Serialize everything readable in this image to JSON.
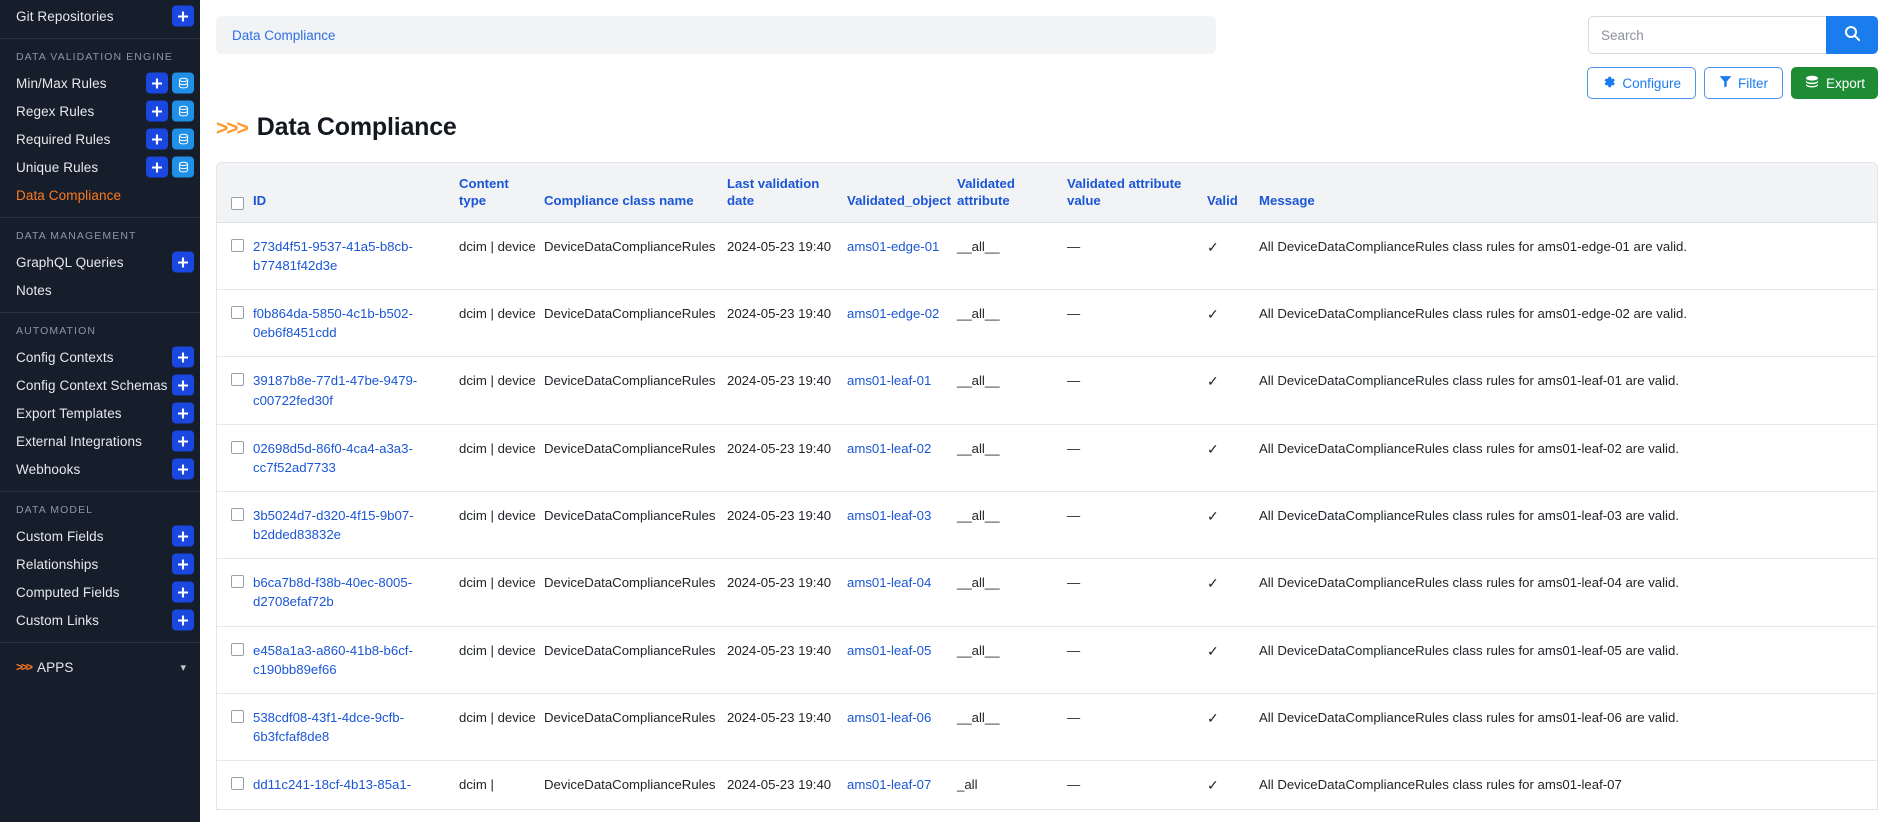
{
  "sidebar": {
    "top_item": {
      "label": "Git Repositories"
    },
    "sections": [
      {
        "title": "DATA VALIDATION ENGINE",
        "items": [
          {
            "label": "Min/Max Rules",
            "active": false,
            "add": "+",
            "import": "database-icon"
          },
          {
            "label": "Regex Rules",
            "active": false,
            "add": "+",
            "import": "database-icon"
          },
          {
            "label": "Required Rules",
            "active": false,
            "add": "+",
            "import": "database-icon"
          },
          {
            "label": "Unique Rules",
            "active": false,
            "add": "+",
            "import": "database-icon"
          },
          {
            "label": "Data Compliance",
            "active": true
          }
        ]
      },
      {
        "title": "DATA MANAGEMENT",
        "items": [
          {
            "label": "GraphQL Queries",
            "add": "+"
          },
          {
            "label": "Notes"
          }
        ]
      },
      {
        "title": "AUTOMATION",
        "items": [
          {
            "label": "Config Contexts",
            "add": "+"
          },
          {
            "label": "Config Context Schemas",
            "add": "+"
          },
          {
            "label": "Export Templates",
            "add": "+"
          },
          {
            "label": "External Integrations",
            "add": "+"
          },
          {
            "label": "Webhooks",
            "add": "+"
          }
        ]
      },
      {
        "title": "DATA MODEL",
        "items": [
          {
            "label": "Custom Fields",
            "add": "+"
          },
          {
            "label": "Relationships",
            "add": "+"
          },
          {
            "label": "Computed Fields",
            "add": "+"
          },
          {
            "label": "Custom Links",
            "add": "+"
          }
        ]
      }
    ],
    "apps": {
      "label": "APPS",
      "chevron": ">>>"
    }
  },
  "topbar": {
    "breadcrumb": "Data Compliance",
    "search": {
      "placeholder": "Search",
      "value": "",
      "button_icon": "search-icon"
    }
  },
  "actions": {
    "configure": "Configure",
    "filter": "Filter",
    "export": "Export"
  },
  "page": {
    "chevron": ">>>",
    "title": "Data Compliance"
  },
  "table": {
    "columns": [
      "ID",
      "Content type",
      "Compliance class name",
      "Last validation date",
      "Validated_object",
      "Validated attribute",
      "Validated attribute value",
      "Valid",
      "Message"
    ],
    "rows": [
      {
        "id": "273d4f51-9537-41a5-b8cb-b77481f42d3e",
        "content_type": "dcim | device",
        "class_name": "DeviceDataComplianceRules",
        "last_validation_date": "2024-05-23 19:40",
        "validated_object": "ams01-edge-01",
        "validated_attribute": "__all__",
        "validated_attribute_value": "—",
        "valid": "✓",
        "message": "All DeviceDataComplianceRules class rules for ams01-edge-01 are valid."
      },
      {
        "id": "f0b864da-5850-4c1b-b502-0eb6f8451cdd",
        "content_type": "dcim | device",
        "class_name": "DeviceDataComplianceRules",
        "last_validation_date": "2024-05-23 19:40",
        "validated_object": "ams01-edge-02",
        "validated_attribute": "__all__",
        "validated_attribute_value": "—",
        "valid": "✓",
        "message": "All DeviceDataComplianceRules class rules for ams01-edge-02 are valid."
      },
      {
        "id": "39187b8e-77d1-47be-9479-c00722fed30f",
        "content_type": "dcim | device",
        "class_name": "DeviceDataComplianceRules",
        "last_validation_date": "2024-05-23 19:40",
        "validated_object": "ams01-leaf-01",
        "validated_attribute": "__all__",
        "validated_attribute_value": "—",
        "valid": "✓",
        "message": "All DeviceDataComplianceRules class rules for ams01-leaf-01 are valid."
      },
      {
        "id": "02698d5d-86f0-4ca4-a3a3-cc7f52ad7733",
        "content_type": "dcim | device",
        "class_name": "DeviceDataComplianceRules",
        "last_validation_date": "2024-05-23 19:40",
        "validated_object": "ams01-leaf-02",
        "validated_attribute": "__all__",
        "validated_attribute_value": "—",
        "valid": "✓",
        "message": "All DeviceDataComplianceRules class rules for ams01-leaf-02 are valid."
      },
      {
        "id": "3b5024d7-d320-4f15-9b07-b2dded83832e",
        "content_type": "dcim | device",
        "class_name": "DeviceDataComplianceRules",
        "last_validation_date": "2024-05-23 19:40",
        "validated_object": "ams01-leaf-03",
        "validated_attribute": "__all__",
        "validated_attribute_value": "—",
        "valid": "✓",
        "message": "All DeviceDataComplianceRules class rules for ams01-leaf-03 are valid."
      },
      {
        "id": "b6ca7b8d-f38b-40ec-8005-d2708efaf72b",
        "content_type": "dcim | device",
        "class_name": "DeviceDataComplianceRules",
        "last_validation_date": "2024-05-23 19:40",
        "validated_object": "ams01-leaf-04",
        "validated_attribute": "__all__",
        "validated_attribute_value": "—",
        "valid": "✓",
        "message": "All DeviceDataComplianceRules class rules for ams01-leaf-04 are valid."
      },
      {
        "id": "e458a1a3-a860-41b8-b6cf-c190bb89ef66",
        "content_type": "dcim | device",
        "class_name": "DeviceDataComplianceRules",
        "last_validation_date": "2024-05-23 19:40",
        "validated_object": "ams01-leaf-05",
        "validated_attribute": "__all__",
        "validated_attribute_value": "—",
        "valid": "✓",
        "message": "All DeviceDataComplianceRules class rules for ams01-leaf-05 are valid."
      },
      {
        "id": "538cdf08-43f1-4dce-9cfb-6b3fcfaf8de8",
        "content_type": "dcim | device",
        "class_name": "DeviceDataComplianceRules",
        "last_validation_date": "2024-05-23 19:40",
        "validated_object": "ams01-leaf-06",
        "validated_attribute": "__all__",
        "validated_attribute_value": "—",
        "valid": "✓",
        "message": "All DeviceDataComplianceRules class rules for ams01-leaf-06 are valid."
      },
      {
        "id": "dd11c241-18cf-4b13-85a1-",
        "content_type": "dcim |",
        "class_name": "DeviceDataComplianceRules",
        "last_validation_date": "2024-05-23 19:40",
        "validated_object": "ams01-leaf-07",
        "validated_attribute": "_all",
        "validated_attribute_value": "—",
        "valid": "✓",
        "message": "All DeviceDataComplianceRules class rules for ams01-leaf-07"
      }
    ]
  },
  "colors": {
    "sidebar_bg": "#161d2b",
    "accent_orange": "#ff7a21",
    "link_blue": "#1a56d6",
    "primary_blue": "#1b7ced",
    "add_blue": "#1a47e0",
    "import_blue": "#1f8fe8",
    "export_green": "#1e8b35"
  }
}
